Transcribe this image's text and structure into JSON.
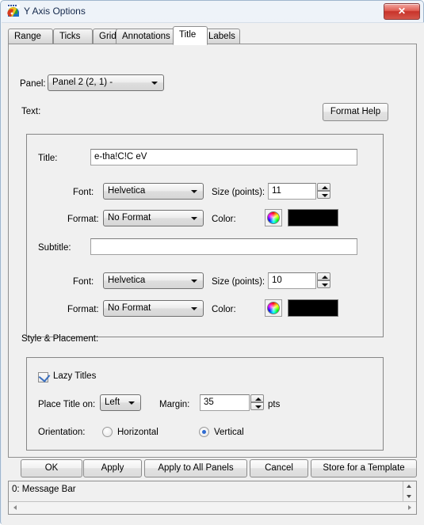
{
  "window": {
    "title": "Y Axis Options",
    "icon": "app-palette-icon",
    "close_label": "✕"
  },
  "tabs": [
    {
      "label": "Range",
      "active": false
    },
    {
      "label": "Ticks",
      "active": false
    },
    {
      "label": "Grid",
      "active": false
    },
    {
      "label": "Annotations",
      "active": false
    },
    {
      "label": "Title",
      "active": true
    },
    {
      "label": "Labels",
      "active": false
    }
  ],
  "panel": {
    "label": "Panel:",
    "value": "Panel 2 (2, 1)  -"
  },
  "text_section": {
    "label": "Text:",
    "format_help_label": "Format Help",
    "title": {
      "label": "Title:",
      "value": "e-tha!C!C eV",
      "font_label": "Font:",
      "font_value": "Helvetica",
      "size_label": "Size (points):",
      "size_value": "11",
      "format_label": "Format:",
      "format_value": "No Format",
      "color_label": "Color:",
      "color_value": "#000000"
    },
    "subtitle": {
      "label": "Subtitle:",
      "value": "",
      "font_label": "Font:",
      "font_value": "Helvetica",
      "size_label": "Size (points):",
      "size_value": "10",
      "format_label": "Format:",
      "format_value": "No Format",
      "color_label": "Color:",
      "color_value": "#000000"
    }
  },
  "style_section": {
    "label": "Style & Placement:",
    "lazy_titles_label": "Lazy Titles",
    "lazy_titles_checked": true,
    "place_title_label": "Place Title on:",
    "place_title_value": "Left",
    "margin_label": "Margin:",
    "margin_value": "35",
    "margin_units": "pts",
    "orientation_label": "Orientation:",
    "orientation_horizontal_label": "Horizontal",
    "orientation_vertical_label": "Vertical",
    "orientation_selected": "Vertical"
  },
  "buttons": {
    "ok": "OK",
    "apply": "Apply",
    "apply_all": "Apply to All Panels",
    "cancel": "Cancel",
    "store_template": "Store for a Template"
  },
  "message_bar": {
    "text": "0: Message Bar"
  }
}
